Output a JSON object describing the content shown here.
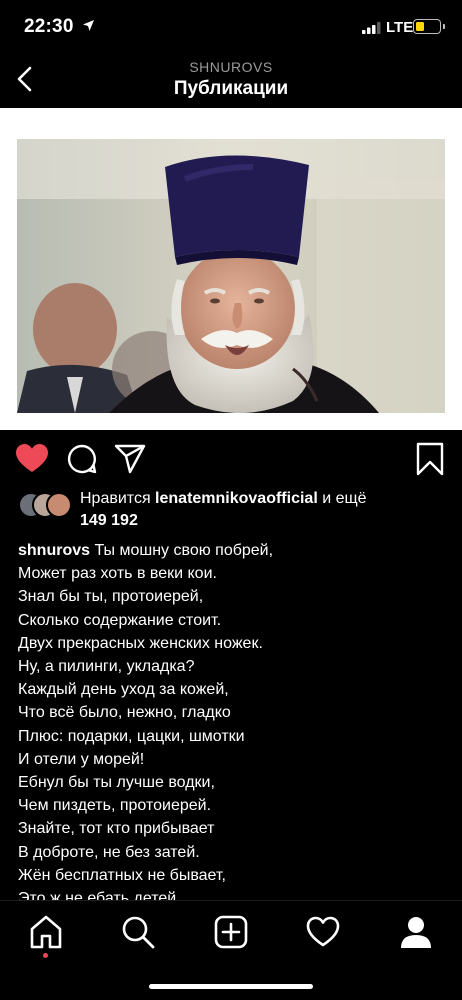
{
  "status_bar": {
    "time": "22:30",
    "network": "LTE"
  },
  "header": {
    "username": "SHNUROVS",
    "title": "Публикации"
  },
  "post": {
    "likes": {
      "prefix": "Нравится ",
      "liker": "lenatemnikovaofficial",
      "connector": " и ещё",
      "count": "149 192"
    },
    "caption": {
      "username": "shnurovs",
      "first_line": " Ты мошну свою побрей,",
      "rest": "Может раз хоть в веки кои.\nЗнал бы ты, протоиерей,\nСколько содержание стоит.\nДвух прекрасных женских ножек.\nНу, а пилинги, укладка?\nКаждый день уход за кожей,\nЧто всё было, нежно, гладко\nПлюс: подарки, цацки, шмотки\nИ отели у морей!\nЕбнул бы ты лучше водки,\nЧем пиздеть, протоиерей.\nЗнайте, тот кто прибывает\nВ доброте, не без затей.\nЖён бесплатных не бывает,\nЭто ж не ебать детей."
    }
  },
  "colors": {
    "background": "#000000",
    "like_red": "#ed4956",
    "battery_yellow": "#ffd60a",
    "subtitle_gray": "#9a9a9a"
  },
  "icons": {
    "back": "chevron-left-icon",
    "like": "heart-filled-icon",
    "comment": "comment-bubble-icon",
    "share": "paper-plane-icon",
    "save": "bookmark-icon",
    "tabs": [
      "home-icon",
      "search-icon",
      "add-post-icon",
      "activity-heart-icon",
      "profile-icon"
    ]
  }
}
